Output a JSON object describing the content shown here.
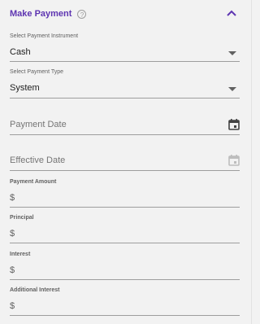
{
  "header": {
    "title": "Make Payment"
  },
  "icons": {
    "help": "help-circle-icon",
    "collapse": "chevron-up-icon",
    "calendar": "calendar-icon",
    "dropdown": "dropdown-arrow-icon"
  },
  "colors": {
    "accent": "#5e35b1",
    "underline": "#9e9e9e",
    "background": "#f2f2f2"
  },
  "fields": {
    "instrument": {
      "label": "Select Payment Instrument",
      "value": "Cash"
    },
    "type": {
      "label": "Select Payment Type",
      "value": "System"
    },
    "payment_date": {
      "placeholder": "Payment Date"
    },
    "effective_date": {
      "placeholder": "Effective Date"
    },
    "payment_amount": {
      "label": "Payment Amount",
      "prefix": "$"
    },
    "principal": {
      "label": "Principal",
      "prefix": "$"
    },
    "interest": {
      "label": "Interest",
      "prefix": "$"
    },
    "additional_interest": {
      "label": "Additional Interest",
      "prefix": "$"
    }
  }
}
